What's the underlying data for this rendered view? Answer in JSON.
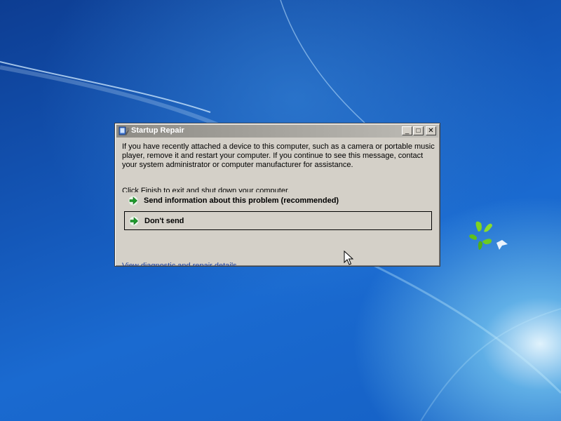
{
  "dialog": {
    "title": "Startup Repair",
    "description": "If you have recently attached a device to this computer, such as a camera or portable music player, remove it and restart your computer. If you continue to see this message, contact your system administrator or computer manufacturer for assistance.",
    "finish_hint": "Click Finish to exit and shut down your computer.",
    "options": {
      "send_label": "Send information about this problem (recommended)",
      "dont_send_label": "Don't send"
    },
    "details_link": "View diagnostic and repair details"
  },
  "titlebar_buttons": {
    "minimize": "_",
    "maximize": "□",
    "close": "✕"
  },
  "icons": {
    "app": "startup-repair-icon",
    "option_arrow": "green-arrow-icon",
    "cursor": "mouse-pointer-icon",
    "wallpaper_logo": "windows-logo-icon"
  },
  "colors": {
    "arrow_green": "#1e9a2c",
    "dialog_bg": "#d4d0c8",
    "desktop_blue": "#1457b8"
  }
}
